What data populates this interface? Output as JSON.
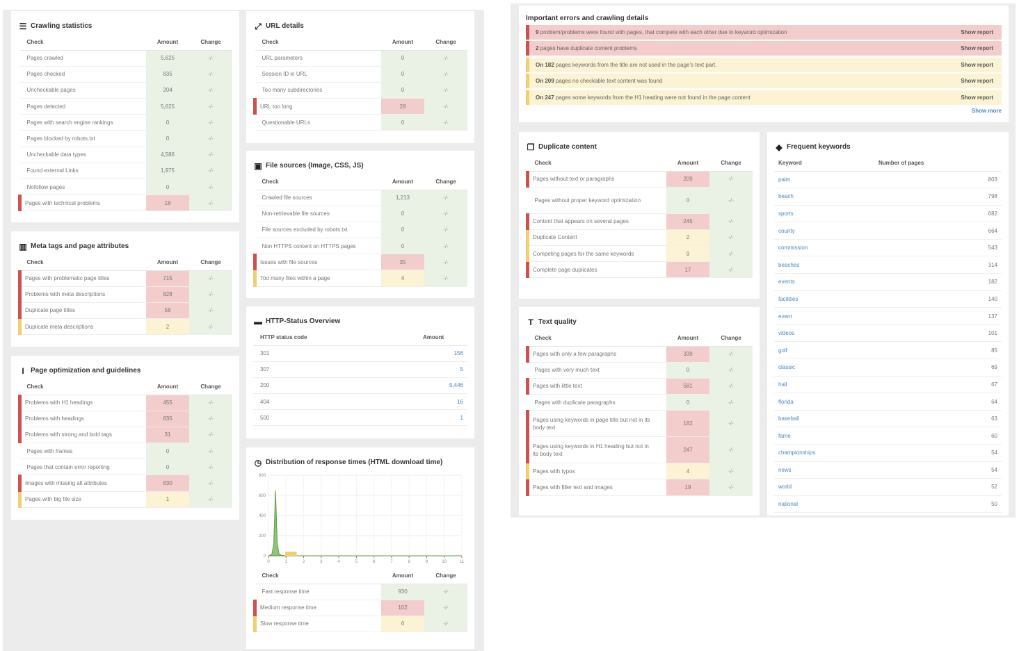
{
  "crawling": {
    "title": "Crawling statistics",
    "head": [
      "Check",
      "Amount",
      "Change"
    ],
    "rows": [
      [
        "Pages crawled",
        "5,625",
        "-/-",
        ""
      ],
      [
        "Pages checked",
        "835",
        "-/-",
        ""
      ],
      [
        "Uncheckable pages",
        "204",
        "-/-",
        ""
      ],
      [
        "Pages detected",
        "5,625",
        "-/-",
        ""
      ],
      [
        "Pages with search engine rankings",
        "0",
        "-/-",
        ""
      ],
      [
        "Pages blocked by robots.txt",
        "0",
        "-/-",
        ""
      ],
      [
        "Uncheckable data types",
        "4,586",
        "-/-",
        ""
      ],
      [
        "Found external Links",
        "1,975",
        "-/-",
        ""
      ],
      [
        "Nofollow pages",
        "0",
        "-/-",
        ""
      ],
      [
        "Pages with technical problems",
        "18",
        "-/-",
        "red"
      ]
    ]
  },
  "meta": {
    "title": "Meta tags and page attributes",
    "head": [
      "Check",
      "Amount",
      "Change"
    ],
    "rows": [
      [
        "Pages with problematic page titles",
        "715",
        "-/-",
        "red"
      ],
      [
        "Problems with meta descriptions",
        "828",
        "-/-",
        "red"
      ],
      [
        "Duplicate page titles",
        "58",
        "-/-",
        "red"
      ],
      [
        "Duplicate meta descriptions",
        "2",
        "-/-",
        "yel"
      ]
    ]
  },
  "pageopt": {
    "title": "Page optimization and guidelines",
    "head": [
      "Check",
      "Amount",
      "Change"
    ],
    "rows": [
      [
        "Problems with H1 headings",
        "455",
        "-/-",
        "red"
      ],
      [
        "Problems with headings",
        "835",
        "-/-",
        "red"
      ],
      [
        "Problems with strong and bold tags",
        "31",
        "-/-",
        "red"
      ],
      [
        "Pages with frames",
        "0",
        "-/-",
        ""
      ],
      [
        "Pages that contain error reporting",
        "0",
        "-/-",
        ""
      ],
      [
        "Images with missing alt attributes",
        "830",
        "-/-",
        "red"
      ],
      [
        "Pages with big file size",
        "1",
        "-/-",
        "yel"
      ]
    ]
  },
  "url": {
    "title": "URL details",
    "head": [
      "Check",
      "Amount",
      "Change"
    ],
    "rows": [
      [
        "URL parameters",
        "0",
        "-/-",
        ""
      ],
      [
        "Session ID in URL",
        "0",
        "-/-",
        ""
      ],
      [
        "Too many subdirectories",
        "0",
        "-/-",
        ""
      ],
      [
        "URL too long",
        "28",
        "-/-",
        "red"
      ],
      [
        "Questionable URLs",
        "0",
        "-/-",
        ""
      ]
    ]
  },
  "files": {
    "title": "File sources (Image, CSS, JS)",
    "head": [
      "Check",
      "Amount",
      "Change"
    ],
    "rows": [
      [
        "Crawled file sources",
        "1,213",
        "-/-",
        ""
      ],
      [
        "Non-retrievable file sources",
        "0",
        "-/-",
        ""
      ],
      [
        "File sources excluded by robots.txt",
        "0",
        "-/-",
        ""
      ],
      [
        "Non HTTPS content on HTTPS pages",
        "0",
        "-/-",
        ""
      ],
      [
        "Issues with file sources",
        "35",
        "-/-",
        "red"
      ],
      [
        "Too many files within a page",
        "4",
        "-/-",
        "yel"
      ]
    ]
  },
  "http": {
    "title": "HTTP-Status Overview",
    "head": [
      "HTTP status code",
      "Amount"
    ],
    "rows": [
      [
        "301",
        "156"
      ],
      [
        "307",
        "5"
      ],
      [
        "200",
        "5,446"
      ],
      [
        "404",
        "16"
      ],
      [
        "500",
        "1"
      ]
    ]
  },
  "resp": {
    "title": "Distribution of response times (HTML download time)",
    "head": [
      "Check",
      "Amount",
      "Change"
    ],
    "rows": [
      [
        "Fast response time",
        "930",
        "-/-",
        ""
      ],
      [
        "Medium response time",
        "102",
        "-/-",
        "red"
      ],
      [
        "Slow response time",
        "6",
        "-/-",
        "yel"
      ]
    ]
  },
  "chart_data": {
    "type": "area",
    "x": [
      0,
      0.1,
      0.2,
      0.3,
      0.4,
      0.5,
      0.6,
      0.7,
      0.8,
      0.9,
      1,
      1.5,
      2,
      3,
      4,
      5,
      6,
      7,
      8,
      9,
      10,
      11
    ],
    "values": [
      0,
      5,
      20,
      120,
      650,
      120,
      20,
      8,
      4,
      2,
      1,
      0,
      0,
      0,
      0,
      0,
      0,
      0,
      0,
      0,
      0,
      0
    ],
    "xlim": [
      0,
      11
    ],
    "ylim": [
      0,
      800
    ],
    "xticks": [
      "0",
      "1",
      "2",
      "3",
      "4",
      "5",
      "6",
      "7",
      "8",
      "9",
      "10",
      "11"
    ],
    "yticks": [
      "0",
      "200",
      "400",
      "600",
      "800"
    ]
  },
  "errors": {
    "title": "Important errors and crawling details",
    "items": [
      {
        "pre": "9",
        "text": " problem/problems were found with pages, that compete with each other due to keyword optimization",
        "level": "r"
      },
      {
        "pre": "2",
        "text": " pages have duplicate content problems",
        "level": "r"
      },
      {
        "pre": "On 182",
        "text": " pages keywords from the title are not used in the page's text part.",
        "level": "y"
      },
      {
        "pre": "On 209",
        "text": " pages no checkable text content was found",
        "level": "y"
      },
      {
        "pre": "On 247",
        "text": " pages some keywords from the H1 heading were not found in the page content",
        "level": "y"
      }
    ],
    "show": "Show report",
    "more": "Show more"
  },
  "dup": {
    "title": "Duplicate content",
    "head": [
      "Check",
      "Amount",
      "Change"
    ],
    "rows": [
      [
        "Pages without text or paragraphs",
        "209",
        "-/-",
        "red"
      ],
      [
        "Pages without proper keyword optimization",
        "0",
        "-/-",
        ""
      ],
      [
        "Content that appears on several pages",
        "245",
        "-/-",
        "red"
      ],
      [
        "Duplicate Content",
        "2",
        "-/-",
        "yel"
      ],
      [
        "Competing pages for the same keywords",
        "9",
        "-/-",
        "yel"
      ],
      [
        "Complete page duplicates",
        "17",
        "-/-",
        "red"
      ]
    ]
  },
  "textq": {
    "title": "Text quality",
    "head": [
      "Check",
      "Amount",
      "Change"
    ],
    "rows": [
      [
        "Pages with only a few paragraphs",
        "339",
        "-/-",
        "red"
      ],
      [
        "Pages with very much text",
        "0",
        "-/-",
        ""
      ],
      [
        "Pages with little text",
        "581",
        "-/-",
        "red"
      ],
      [
        "Pages with duplicate paragraphs",
        "0",
        "-/-",
        ""
      ],
      [
        "Pages using keywords in page title but not in its body text",
        "182",
        "-/-",
        "red"
      ],
      [
        "Pages using keywords in H1 heading but not in its body text",
        "247",
        "-/-",
        "red"
      ],
      [
        "Pages with typos",
        "4",
        "-/-",
        "yel"
      ],
      [
        "Pages with filler text and images",
        "19",
        "-/-",
        "red"
      ]
    ]
  },
  "keywords": {
    "title": "Frequent keywords",
    "head": [
      "Keyword",
      "Number of pages"
    ],
    "rows": [
      [
        "palm",
        "803"
      ],
      [
        "beach",
        "798"
      ],
      [
        "sports",
        "682"
      ],
      [
        "county",
        "664"
      ],
      [
        "commission",
        "543"
      ],
      [
        "beaches",
        "314"
      ],
      [
        "events",
        "182"
      ],
      [
        "facilities",
        "140"
      ],
      [
        "event",
        "137"
      ],
      [
        "videos",
        "101"
      ],
      [
        "golf",
        "85"
      ],
      [
        "classic",
        "69"
      ],
      [
        "hall",
        "67"
      ],
      [
        "florida",
        "64"
      ],
      [
        "baseball",
        "63"
      ],
      [
        "fame",
        "60"
      ],
      [
        "championships",
        "54"
      ],
      [
        "news",
        "54"
      ],
      [
        "world",
        "52"
      ],
      [
        "national",
        "50"
      ]
    ]
  }
}
